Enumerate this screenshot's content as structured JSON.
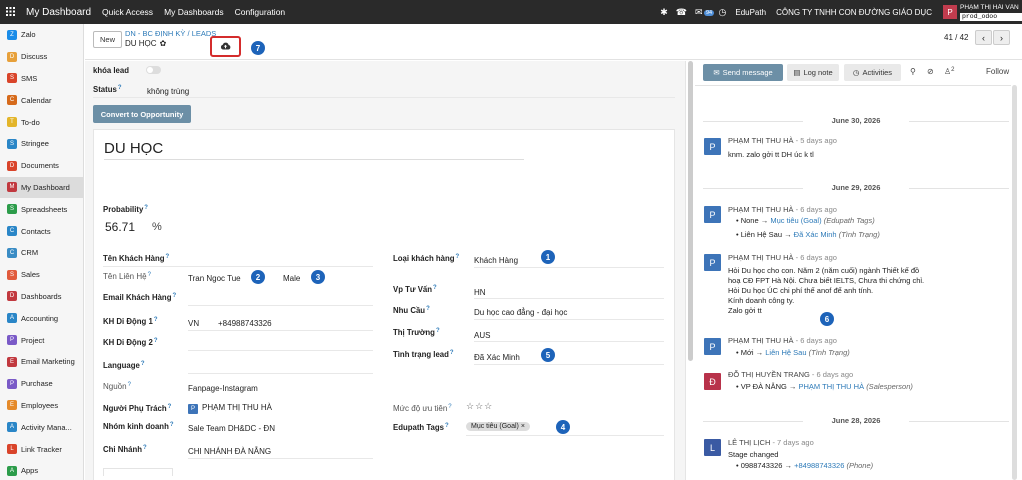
{
  "topbar": {
    "app_title": "My Dashboard",
    "menus": [
      "Quick Access",
      "My Dashboards",
      "Configuration"
    ],
    "notification_count": "94",
    "workspace": "EduPath",
    "company": "CÔNG TY TNHH CON ĐƯỜNG GIÁO DỤC",
    "user_initial": "P",
    "user_name": "PHẠM THỊ HẢI VÂN",
    "database": "prod_odoo"
  },
  "sidebar": {
    "items": [
      {
        "label": "Zalo",
        "color": "#1a8ce8",
        "icon": "zalo-icon"
      },
      {
        "label": "Discuss",
        "color": "#e7a03a",
        "icon": "chat-icon"
      },
      {
        "label": "SMS",
        "color": "#d9442a",
        "icon": "sms-icon"
      },
      {
        "label": "Calendar",
        "color": "#d66a1b",
        "icon": "calendar-icon"
      },
      {
        "label": "To-do",
        "color": "#e3b52a",
        "icon": "todo-icon"
      },
      {
        "label": "Stringee",
        "color": "#2a86c7",
        "icon": "phone-icon"
      },
      {
        "label": "Documents",
        "color": "#d9442a",
        "icon": "folder-icon"
      },
      {
        "label": "My Dashboard",
        "color": "#c1393f",
        "icon": "dashboard-icon"
      },
      {
        "label": "Spreadsheets",
        "color": "#2c9c4a",
        "icon": "spreadsheet-icon"
      },
      {
        "label": "Contacts",
        "color": "#2a86c7",
        "icon": "contacts-icon"
      },
      {
        "label": "CRM",
        "color": "#3a8cc4",
        "icon": "crm-icon"
      },
      {
        "label": "Sales",
        "color": "#e15a3c",
        "icon": "sales-icon"
      },
      {
        "label": "Dashboards",
        "color": "#c1393f",
        "icon": "chart-icon"
      },
      {
        "label": "Accounting",
        "color": "#2a86c7",
        "icon": "accounting-icon"
      },
      {
        "label": "Project",
        "color": "#7a5ac7",
        "icon": "project-icon"
      },
      {
        "label": "Email Marketing",
        "color": "#c1393f",
        "icon": "email-icon"
      },
      {
        "label": "Purchase",
        "color": "#7a5ac7",
        "icon": "purchase-icon"
      },
      {
        "label": "Employees",
        "color": "#e58a2a",
        "icon": "employees-icon"
      },
      {
        "label": "Activity Mana...",
        "color": "#2a86c7",
        "icon": "activity-icon"
      },
      {
        "label": "Link Tracker",
        "color": "#d9442a",
        "icon": "link-icon"
      },
      {
        "label": "Apps",
        "color": "#2c9c4a",
        "icon": "apps-icon"
      }
    ],
    "active": "My Dashboard"
  },
  "breadcrumb": {
    "new_label": "New",
    "path": [
      "DN - BC ĐỊNH KỲ",
      "LEADS"
    ],
    "current": "DU HỌC",
    "pager": "41 / 42"
  },
  "annotations": [
    "1",
    "2",
    "3",
    "4",
    "5",
    "6",
    "7"
  ],
  "form": {
    "lock_label": "khóa lead",
    "status_label": "Status",
    "status_value": "không trùng",
    "convert_label": "Convert to Opportunity",
    "title": "DU HỌC",
    "probability_label": "Probability",
    "probability_value": "56.71",
    "probability_unit": "%",
    "left": {
      "customer_name": "Tên Khách Hàng",
      "contact_name_label": "Tên Liên Hệ",
      "contact_name_value": "Tran Ngoc Tue",
      "gender_value": "Male",
      "email_label": "Email Khách Hàng",
      "mobile1_label": "KH Di Động 1",
      "mobile1_country": "VN",
      "mobile1_value": "+84988743326",
      "mobile2_label": "KH Di Động 2",
      "language_label": "Language",
      "source_label": "Nguồn",
      "source_value": "Fanpage-Instagram",
      "owner_label": "Người Phụ Trách",
      "owner_initial": "P",
      "owner_value": "PHẠM THỊ THU HÀ",
      "team_label": "Nhóm kinh doanh",
      "team_value": "Sale Team DH&DC - ĐN",
      "branch_label": "Chi Nhánh",
      "branch_value": "CHI NHÁNH ĐÀ NẴNG"
    },
    "right": {
      "customer_type_label": "Loại khách hàng",
      "customer_type_value": "Khách Hàng",
      "consult_label": "Vp Tư Vấn",
      "consult_value": "HN",
      "need_label": "Nhu Cầu",
      "need_value": "Du học cao đẳng - đại học",
      "market_label": "Thị Trường",
      "market_value": "AUS",
      "lead_status_label": "Tình trạng lead",
      "lead_status_value": "Đã Xác Minh",
      "priority_label": "Mức độ ưu tiên",
      "tags_label": "Edupath Tags",
      "tag_value": "Mục tiêu (Goal)"
    }
  },
  "chatter": {
    "send_label": "Send message",
    "log_label": "Log note",
    "activities_label": "Activities",
    "followers_count": "2",
    "follow_label": "Follow",
    "dates": [
      "June 30, 2026",
      "June 29, 2026",
      "June 28, 2026"
    ],
    "messages": [
      {
        "initial": "P",
        "author": "PHẠM THỊ THU HÀ",
        "time": "- 5 days ago",
        "lines": [
          "knm. zalo gởi tt DH úc k tl"
        ]
      },
      {
        "initial": "P",
        "author": "PHẠM THỊ THU HÀ",
        "time": "- 6 days ago",
        "changes": [
          {
            "old": "None",
            "new": "Mục tiêu (Goal)",
            "field": "(Edupath Tags)"
          },
          {
            "old": "Liên Hệ Sau",
            "new": "Đã Xác Minh",
            "field": "(Tình Trạng)"
          }
        ]
      },
      {
        "initial": "P",
        "author": "PHẠM THỊ THU HÀ",
        "time": "- 6 days ago",
        "lines": [
          "Hỏi Du học cho con. Năm 2 (năm cuối) ngành Thiết kế đồ",
          "hoạ CĐ FPT Hà Nội. Chưa biết IELTS, Chưa thi chứng chỉ.",
          "Hỏi Du học ÚC chi phí thế anof để anh tính.",
          "Kính doanh công ty.",
          "Zalo gởi tt"
        ]
      },
      {
        "initial": "P",
        "author": "PHẠM THỊ THU HÀ",
        "time": "- 6 days ago",
        "changes": [
          {
            "old": "Mới",
            "new": "Liên Hệ Sau",
            "field": "(Tình Trạng)"
          }
        ]
      },
      {
        "initial": "Đ",
        "author": "ĐỖ THỊ HUYỀN TRANG",
        "time": "- 6 days ago",
        "changes": [
          {
            "old": "VP ĐÀ NẴNG",
            "new": "PHẠM THỊ THU HÀ",
            "field": "(Salesperson)"
          }
        ]
      },
      {
        "initial": "L",
        "author": "LÊ THỊ LỊCH",
        "time": "- 7 days ago",
        "lines": [
          "Stage changed"
        ],
        "changes": [
          {
            "old": "0988743326",
            "new": "+84988743326",
            "field": "(Phone)"
          }
        ]
      }
    ]
  }
}
